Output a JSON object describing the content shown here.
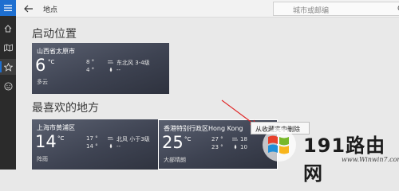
{
  "app": {
    "title": "地点",
    "search_placeholder": "城市或邮编"
  },
  "nav": {
    "items": [
      {
        "icon": "menu-icon"
      },
      {
        "icon": "home-icon"
      },
      {
        "icon": "map-icon"
      },
      {
        "icon": "star-icon",
        "active": true
      },
      {
        "icon": "smiley-icon"
      }
    ]
  },
  "sections": {
    "launch_title": "启动位置",
    "favorites_title": "最喜欢的地方"
  },
  "launch": {
    "city": "山西省太原市",
    "temp": "6",
    "unit": "°C",
    "desc": "多云",
    "hi": "8 °",
    "lo": "4 °",
    "wind": "东北风 3-4级",
    "extra": "--"
  },
  "favorites": [
    {
      "city": "上海市黄浦区",
      "temp": "14",
      "unit": "°C",
      "desc": "阵雨",
      "hi": "17 °",
      "lo": "14 °",
      "wind": "北风 小于3级",
      "extra": "--"
    },
    {
      "city": "香港特别行政区Hong Kong",
      "temp": "25",
      "unit": "°C",
      "desc": "大部晴朗",
      "hi": "27 °",
      "lo": "23 °",
      "wind": "18",
      "extra": "10"
    }
  ],
  "context_menu": {
    "item": "从收藏夹中删除"
  },
  "watermark": {
    "brand": "191路由网",
    "url": "www.Winwin7.com"
  },
  "colors": {
    "accent": "#1e6fd0",
    "rail": "#2b2b2b",
    "annotation_arrow": "#e02020"
  }
}
